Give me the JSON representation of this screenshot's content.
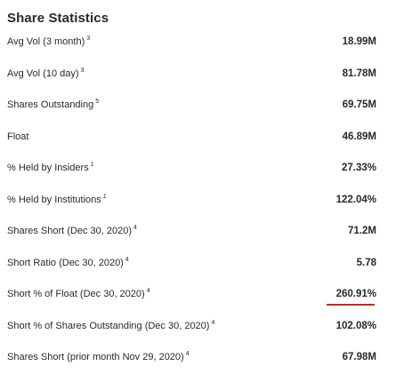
{
  "section": {
    "title": "Share Statistics"
  },
  "colors": {
    "accent": "#c42b25",
    "text": "#232a31"
  },
  "rows": [
    {
      "label": "Avg Vol (3 month)",
      "note": "3",
      "value": "18.99M"
    },
    {
      "label": "Avg Vol (10 day)",
      "note": "3",
      "value": "81.78M"
    },
    {
      "label": "Shares Outstanding",
      "note": "5",
      "value": "69.75M"
    },
    {
      "label": "Float",
      "note": "",
      "value": "46.89M"
    },
    {
      "label": "% Held by Insiders",
      "note": "1",
      "value": "27.33%"
    },
    {
      "label": "% Held by Institutions",
      "note": "1",
      "value": "122.04%"
    },
    {
      "label": "Shares Short (Dec 30, 2020)",
      "note": "4",
      "value": "71.2M"
    },
    {
      "label": "Short Ratio (Dec 30, 2020)",
      "note": "4",
      "value": "5.78"
    },
    {
      "label": "Short % of Float (Dec 30, 2020)",
      "note": "4",
      "value": "260.91%"
    },
    {
      "label": "Short % of Shares Outstanding (Dec 30, 2020)",
      "note": "4",
      "value": "102.08%"
    },
    {
      "label": "Shares Short (prior month Nov 29, 2020)",
      "note": "4",
      "value": "67.98M"
    }
  ]
}
